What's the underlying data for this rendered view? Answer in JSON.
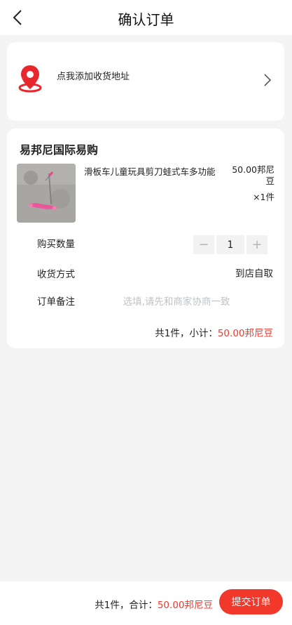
{
  "header": {
    "title": "确认订单",
    "back_icon": "chevron-left-icon"
  },
  "address": {
    "prompt": "点我添加收货地址",
    "icon": "location-pin-icon",
    "arrow_icon": "chevron-right-icon"
  },
  "shop": {
    "name": "易邦尼国际易购",
    "product": {
      "title": "滑板车儿童玩具剪刀蛙式车多功能",
      "price": "50.00邦尼豆",
      "quantity": "×1件",
      "image_icon": "product-thumbnail"
    }
  },
  "form": {
    "quantity_label": "购买数量",
    "quantity_value": "1",
    "minus_label": "−",
    "plus_label": "+",
    "delivery_label": "收货方式",
    "delivery_value": "到店自取",
    "remark_label": "订单备注",
    "remark_placeholder": "选填,请先和商家协商一致",
    "remark_value": ""
  },
  "subtotal": {
    "count_text": "共1件，小计：",
    "amount": "50.00邦尼豆"
  },
  "footer": {
    "count_text": "共1件，合计：",
    "amount": "50.00邦尼豆",
    "submit_label": "提交订单"
  },
  "colors": {
    "accent": "#f2372b",
    "background": "#f4f4f4",
    "card": "#ffffff"
  }
}
